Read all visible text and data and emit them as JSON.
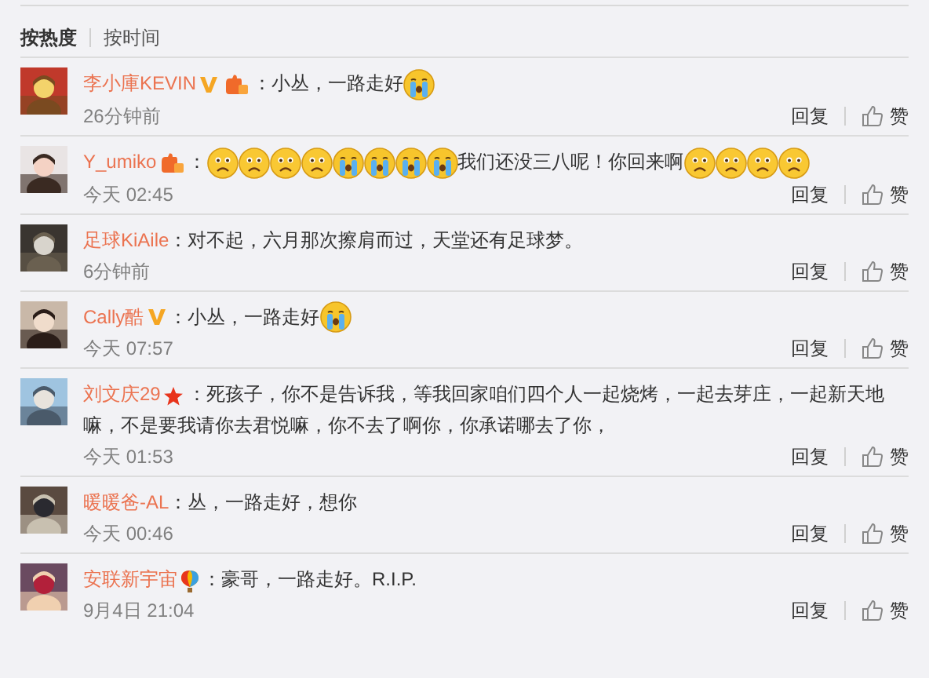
{
  "sort_tabs": [
    {
      "label": "按热度",
      "selected": true
    },
    {
      "label": "按时间",
      "selected": false
    }
  ],
  "comments": [
    {
      "name": "李小庫KEVIN",
      "badges": [
        {
          "kind": "verified"
        },
        {
          "kind": "fan"
        }
      ],
      "content": [
        {
          "kind": "text",
          "text": "：小丛，一路走好"
        },
        {
          "kind": "cry"
        }
      ],
      "time": "26分钟前",
      "reply": "回复",
      "like": "赞"
    },
    {
      "name": "Y_umiko",
      "badges": [
        {
          "kind": "fan"
        }
      ],
      "content": [
        {
          "kind": "text",
          "text": "："
        },
        {
          "kind": "sad"
        },
        {
          "kind": "sad"
        },
        {
          "kind": "sad"
        },
        {
          "kind": "sad"
        },
        {
          "kind": "cry"
        },
        {
          "kind": "cry"
        },
        {
          "kind": "cry"
        },
        {
          "kind": "cry"
        },
        {
          "kind": "text",
          "text": "我们还没三八呢！你回来啊"
        },
        {
          "kind": "sad"
        },
        {
          "kind": "sad"
        },
        {
          "kind": "sad"
        },
        {
          "kind": "sad"
        }
      ],
      "time": "今天 02:45",
      "reply": "回复",
      "like": "赞"
    },
    {
      "name": "足球KiAile",
      "content": [
        {
          "kind": "text",
          "text": "：对不起，六月那次擦肩而过，天堂还有足球梦。"
        }
      ],
      "time": "6分钟前",
      "reply": "回复",
      "like": "赞"
    },
    {
      "name": "Cally酷",
      "badges": [
        {
          "kind": "verified"
        }
      ],
      "content": [
        {
          "kind": "text",
          "text": "：小丛，一路走好"
        },
        {
          "kind": "cry"
        }
      ],
      "time": "今天 07:57",
      "reply": "回复",
      "like": "赞"
    },
    {
      "name": "刘文庆29",
      "badges": [
        {
          "kind": "star"
        }
      ],
      "content": [
        {
          "kind": "text",
          "text": "：死孩子，你不是告诉我，等我回家咱们四个人一起烧烤，一起去芽庄，一起新天地嘛，不是要我请你去君悦嘛，你不去了啊你，你承诺哪去了你，"
        }
      ],
      "time": "今天 01:53",
      "reply": "回复",
      "like": "赞"
    },
    {
      "name": "暖暖爸-AL",
      "content": [
        {
          "kind": "text",
          "text": "：丛，一路走好，想你"
        }
      ],
      "time": "今天 00:46",
      "reply": "回复",
      "like": "赞"
    },
    {
      "name": "安联新宇宙",
      "badges": [
        {
          "kind": "balloon"
        }
      ],
      "content": [
        {
          "kind": "text",
          "text": "：豪哥，一路走好。R.I.P."
        }
      ],
      "time": "9月4日 21:04",
      "reply": "回复",
      "like": "赞"
    }
  ]
}
